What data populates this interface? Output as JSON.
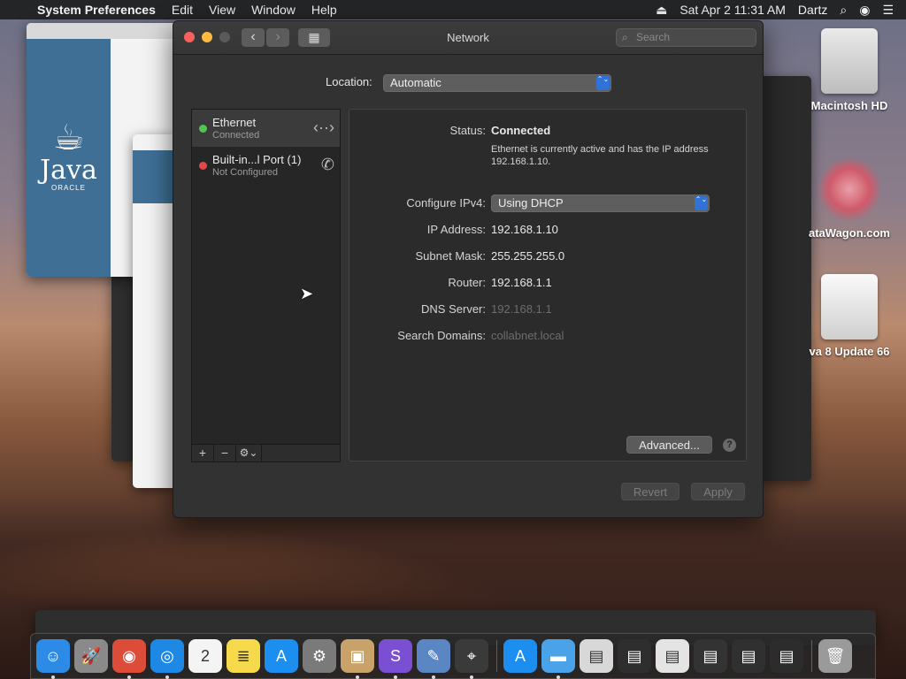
{
  "menubar": {
    "apple": "",
    "app": "System Preferences",
    "items": [
      "Edit",
      "View",
      "Window",
      "Help"
    ],
    "eject": "⏏",
    "datetime": "Sat Apr 2  11:31 AM",
    "user": "Dartz",
    "search": "⌕",
    "siri": "◉",
    "list": "☰"
  },
  "desktop": {
    "icons": [
      {
        "label": "Macintosh HD"
      },
      {
        "label": "ataWagon.com"
      },
      {
        "label": "va 8 Update 66"
      }
    ],
    "java": {
      "word": "Java",
      "oracle": "ORACLE",
      "cup": "☕"
    }
  },
  "window": {
    "title": "Network",
    "search_placeholder": "Search",
    "back": "‹",
    "forward": "›",
    "grid": "▦"
  },
  "location": {
    "label": "Location:",
    "value": "Automatic"
  },
  "services": [
    {
      "name": "Ethernet",
      "status": "Connected",
      "dot_color": "#4cc94c",
      "glyph": "‹··›"
    },
    {
      "name": "Built-in...l Port (1)",
      "status": "Not Configured",
      "dot_color": "#e3474c",
      "glyph": "✆"
    }
  ],
  "service_bar": {
    "add": "+",
    "remove": "−",
    "gear": "⚙⌄"
  },
  "detail": {
    "status_label": "Status:",
    "status_value": "Connected",
    "status_desc": "Ethernet is currently active and has the IP address 192.168.1.10.",
    "configure_label": "Configure IPv4:",
    "configure_value": "Using DHCP",
    "ip_label": "IP Address:",
    "ip_value": "192.168.1.10",
    "subnet_label": "Subnet Mask:",
    "subnet_value": "255.255.255.0",
    "router_label": "Router:",
    "router_value": "192.168.1.1",
    "dns_label": "DNS Server:",
    "dns_value": "192.168.1.1",
    "search_label": "Search Domains:",
    "search_value": "collabnet.local",
    "advanced": "Advanced...",
    "help": "?"
  },
  "footer": {
    "revert": "Revert",
    "apply": "Apply"
  },
  "stepper": "⌃⌄",
  "colors": {
    "accent": "#2f73d9",
    "connected": "#4cc94c",
    "not_configured": "#e3474c"
  },
  "dock": [
    {
      "name": "finder-icon",
      "glyph": "☺",
      "color": "#2b8be6"
    },
    {
      "name": "launchpad-icon",
      "glyph": "🚀",
      "color": "#8a8a8a"
    },
    {
      "name": "chrome-icon",
      "glyph": "◉",
      "color": "#dd4b39"
    },
    {
      "name": "safari-icon",
      "glyph": "◎",
      "color": "#1e88e5"
    },
    {
      "name": "calendar-icon",
      "glyph": "2",
      "color": "#f4f4f4"
    },
    {
      "name": "notes-icon",
      "glyph": "≣",
      "color": "#f7d94c"
    },
    {
      "name": "app-store-icon",
      "glyph": "A",
      "color": "#1c8ef0"
    },
    {
      "name": "system-preferences-icon",
      "glyph": "⚙",
      "color": "#7a7a7a"
    },
    {
      "name": "installer-icon",
      "glyph": "▣",
      "color": "#c9a26a"
    },
    {
      "name": "visual-studio-icon",
      "glyph": "S",
      "color": "#7a4fd1"
    },
    {
      "name": "preview-icon",
      "glyph": "✎",
      "color": "#5a86c4"
    },
    {
      "name": "network-utility-icon",
      "glyph": "⌖",
      "color": "#3a3a3a"
    },
    {
      "name": "app-store-icon-2",
      "glyph": "A",
      "color": "#1c8ef0"
    },
    {
      "name": "folder-icon",
      "glyph": "▬",
      "color": "#4aa3e8"
    },
    {
      "name": "window-thumb-1",
      "glyph": "▤",
      "color": "#d8d8d8"
    },
    {
      "name": "window-thumb-2",
      "glyph": "▤",
      "color": "#2e2e2e"
    },
    {
      "name": "window-thumb-3",
      "glyph": "▤",
      "color": "#e4e4e4"
    },
    {
      "name": "window-thumb-4",
      "glyph": "▤",
      "color": "#333333"
    },
    {
      "name": "window-thumb-5",
      "glyph": "▤",
      "color": "#303030"
    },
    {
      "name": "window-thumb-6",
      "glyph": "▤",
      "color": "#2c2c2c"
    },
    {
      "name": "trash-icon",
      "glyph": "🗑",
      "color": "#9a9a9a"
    }
  ]
}
